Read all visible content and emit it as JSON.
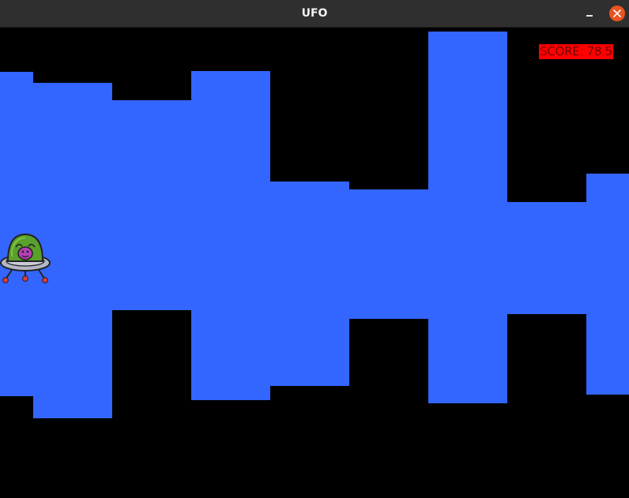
{
  "window": {
    "title": "UFO"
  },
  "game": {
    "score_text": "SCORE: 78.5",
    "player_icon": "ufo-alien-icon",
    "colors": {
      "cave": "#3366ff",
      "rock": "#000000",
      "score_background": "#ff0000",
      "close_button": "#e95420",
      "titlebar": "#2f2f2f"
    }
  }
}
